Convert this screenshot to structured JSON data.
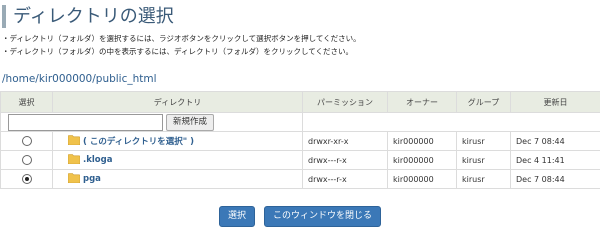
{
  "header": {
    "title": "ディレクトリの選択"
  },
  "notes": [
    "・ディレクトリ（フォルダ）を選択するには、ラジオボタンをクリックして選択ボタンを押してください。",
    "・ディレクトリ（フォルダ）の中を表示するには、ディレクトリ（フォルダ）をクリックしてください。"
  ],
  "current_path": "/home/kir000000/public_html",
  "table": {
    "headers": {
      "select": "選択",
      "directory": "ディレクトリ",
      "permission": "パーミッション",
      "owner": "オーナー",
      "group": "グループ",
      "updated": "更新日"
    },
    "new_folder": {
      "input_value": "",
      "button_label": "新規作成"
    },
    "rows": [
      {
        "selected": false,
        "name": "( このディレクトリを選択\" )",
        "permission": "drwxr-xr-x",
        "owner": "kir000000",
        "group": "kirusr",
        "updated": "Dec 7 08:44"
      },
      {
        "selected": false,
        "name": ".kloga",
        "permission": "drwx---r-x",
        "owner": "kir000000",
        "group": "kirusr",
        "updated": "Dec 4 11:41"
      },
      {
        "selected": true,
        "name": "pga",
        "permission": "drwx---r-x",
        "owner": "kir000000",
        "group": "kirusr",
        "updated": "Dec 7 08:44"
      }
    ]
  },
  "actions": {
    "select_label": "選択",
    "close_label": "このウィンドウを閉じる"
  },
  "colors": {
    "accent": "#3b78b7",
    "folder": "#f0c24b",
    "header_bg": "#e8ece2",
    "link": "#2f5f8f"
  },
  "icons": {
    "folder": "folder-icon"
  }
}
